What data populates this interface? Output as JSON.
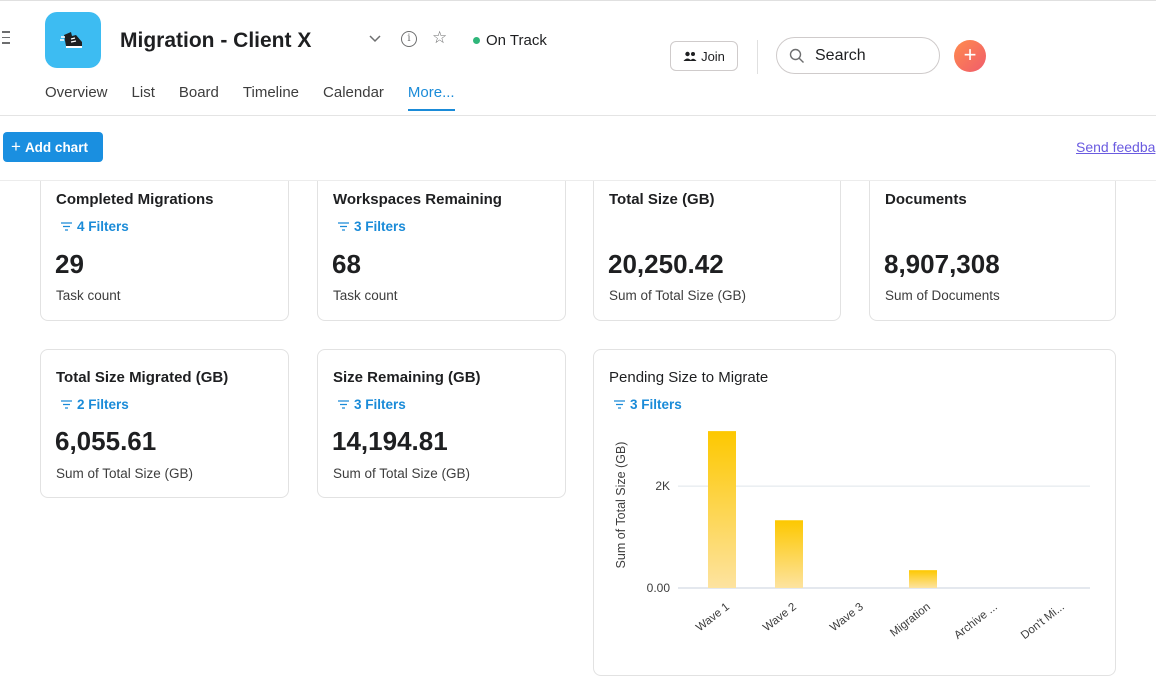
{
  "project": {
    "title": "Migration - Client X",
    "status": "On Track",
    "status_color": "#2fb67a",
    "icon_color": "#3dbcf2"
  },
  "header": {
    "join_label": "Join",
    "search_placeholder": "Search"
  },
  "tabs": [
    {
      "label": "Overview"
    },
    {
      "label": "List"
    },
    {
      "label": "Board"
    },
    {
      "label": "Timeline"
    },
    {
      "label": "Calendar"
    },
    {
      "label": "More..."
    }
  ],
  "toolbar": {
    "add_chart_label": "Add chart",
    "feedback_label": "Send feedba"
  },
  "cards": [
    {
      "title": "Completed Migrations",
      "filters": "4 Filters",
      "value": "29",
      "sub": "Task count"
    },
    {
      "title": "Workspaces Remaining",
      "filters": "3 Filters",
      "value": "68",
      "sub": "Task count"
    },
    {
      "title": "Total Size (GB)",
      "value": "20,250.42",
      "sub": "Sum of Total Size (GB)"
    },
    {
      "title": "Documents",
      "value": "8,907,308",
      "sub": "Sum of Documents"
    },
    {
      "title": "Total Size Migrated (GB)",
      "filters": "2 Filters",
      "value": "6,055.61",
      "sub": "Sum of Total Size (GB)"
    },
    {
      "title": "Size Remaining (GB)",
      "filters": "3 Filters",
      "value": "14,194.81",
      "sub": "Sum of Total Size (GB)"
    }
  ],
  "chart_card": {
    "title": "Pending Size to Migrate",
    "filters": "3 Filters"
  },
  "chart_data": {
    "type": "bar",
    "title": "Pending Size to Migrate",
    "ylabel": "Sum of Total Size (GB)",
    "xlabel": "",
    "categories": [
      "Wave 1",
      "Wave 2",
      "Wave 3",
      "Migration",
      "Archive ...",
      "Don't Mi..."
    ],
    "values": [
      3080,
      1330,
      0,
      350,
      0,
      0
    ],
    "ylim": [
      0,
      3200
    ],
    "yticks": [
      0,
      2000
    ],
    "ytick_labels": [
      "0.00",
      "2K"
    ],
    "bar_color_top": "#fdc800",
    "bar_color_bottom": "#fde3a0",
    "grid": true
  }
}
